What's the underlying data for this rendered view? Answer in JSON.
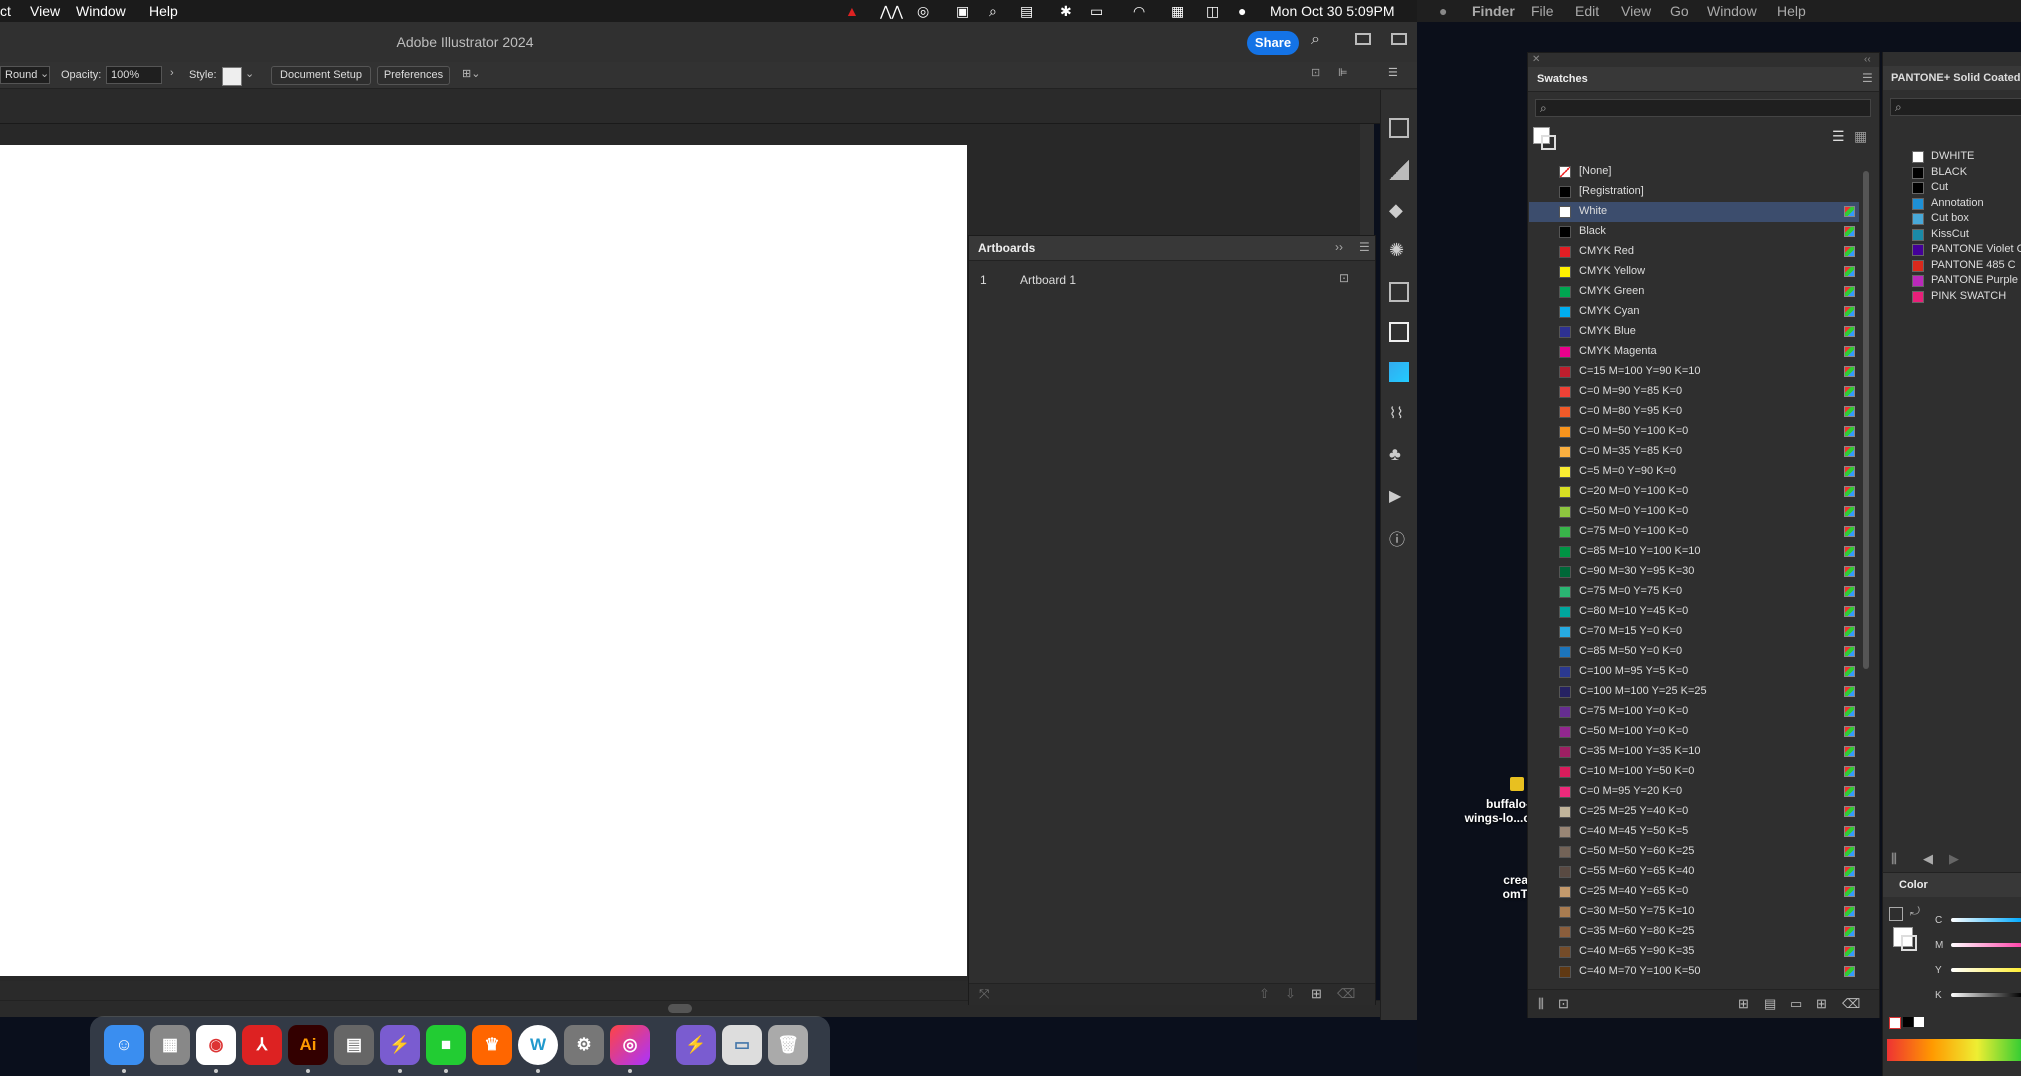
{
  "left_menubar": {
    "items": [
      "ct",
      "View",
      "Window",
      "Help"
    ],
    "clock": "Mon Oct 30  5:09PM"
  },
  "illustrator": {
    "title": "Adobe Illustrator 2024",
    "share_label": "Share",
    "control_bar": {
      "stroke_profile": "Round",
      "opacity_label": "Opacity:",
      "opacity_value": "100%",
      "style_label": "Style:",
      "document_setup": "Document Setup",
      "preferences": "Preferences"
    },
    "artboards_panel": {
      "title": "Artboards",
      "rows": [
        {
          "index": "1",
          "name": "Artboard 1"
        }
      ]
    }
  },
  "right_menubar": {
    "items": [
      "Finder",
      "File",
      "Edit",
      "View",
      "Go",
      "Window",
      "Help"
    ]
  },
  "desktop": {
    "icons": [
      {
        "label_line1": "buffalo-",
        "label_line2": "wings-lo...c"
      },
      {
        "label_line1": "crea",
        "label_line2": "omT"
      }
    ]
  },
  "swatches": {
    "title": "Swatches",
    "colors": {
      "selection": "#3c4d6d",
      "accent": "#1473e6"
    },
    "items": [
      {
        "name": "[None]",
        "color": "none"
      },
      {
        "name": "[Registration]",
        "color": "#000000"
      },
      {
        "name": "White",
        "color": "#ffffff",
        "selected": true
      },
      {
        "name": "Black",
        "color": "#000000"
      },
      {
        "name": "CMYK Red",
        "color": "#e31e24"
      },
      {
        "name": "CMYK Yellow",
        "color": "#fff200"
      },
      {
        "name": "CMYK Green",
        "color": "#00a651"
      },
      {
        "name": "CMYK Cyan",
        "color": "#00aeef"
      },
      {
        "name": "CMYK Blue",
        "color": "#2e3192"
      },
      {
        "name": "CMYK Magenta",
        "color": "#ec008c"
      },
      {
        "name": "C=15 M=100 Y=90 K=10",
        "color": "#be1e2d"
      },
      {
        "name": "C=0 M=90 Y=85 K=0",
        "color": "#ef4136"
      },
      {
        "name": "C=0 M=80 Y=95 K=0",
        "color": "#f15a29"
      },
      {
        "name": "C=0 M=50 Y=100 K=0",
        "color": "#f7941d"
      },
      {
        "name": "C=0 M=35 Y=85 K=0",
        "color": "#fbb040"
      },
      {
        "name": "C=5 M=0 Y=90 K=0",
        "color": "#f9ed32"
      },
      {
        "name": "C=20 M=0 Y=100 K=0",
        "color": "#d7df23"
      },
      {
        "name": "C=50 M=0 Y=100 K=0",
        "color": "#8dc63f"
      },
      {
        "name": "C=75 M=0 Y=100 K=0",
        "color": "#39b54a"
      },
      {
        "name": "C=85 M=10 Y=100 K=10",
        "color": "#009444"
      },
      {
        "name": "C=90 M=30 Y=95 K=30",
        "color": "#006838"
      },
      {
        "name": "C=75 M=0 Y=75 K=0",
        "color": "#2bb673"
      },
      {
        "name": "C=80 M=10 Y=45 K=0",
        "color": "#00a79d"
      },
      {
        "name": "C=70 M=15 Y=0 K=0",
        "color": "#27aae1"
      },
      {
        "name": "C=85 M=50 Y=0 K=0",
        "color": "#1c75bc"
      },
      {
        "name": "C=100 M=95 Y=5 K=0",
        "color": "#2b3990"
      },
      {
        "name": "C=100 M=100 Y=25 K=25",
        "color": "#262262"
      },
      {
        "name": "C=75 M=100 Y=0 K=0",
        "color": "#662d91"
      },
      {
        "name": "C=50 M=100 Y=0 K=0",
        "color": "#92278f"
      },
      {
        "name": "C=35 M=100 Y=35 K=10",
        "color": "#9e1f63"
      },
      {
        "name": "C=10 M=100 Y=50 K=0",
        "color": "#da1c5c"
      },
      {
        "name": "C=0 M=95 Y=20 K=0",
        "color": "#ee2a7b"
      },
      {
        "name": "C=25 M=25 Y=40 K=0",
        "color": "#c2b59b"
      },
      {
        "name": "C=40 M=45 Y=50 K=5",
        "color": "#998675"
      },
      {
        "name": "C=50 M=50 Y=60 K=25",
        "color": "#736357"
      },
      {
        "name": "C=55 M=60 Y=65 K=40",
        "color": "#594a42"
      },
      {
        "name": "C=25 M=40 Y=65 K=0",
        "color": "#c49a6c"
      },
      {
        "name": "C=30 M=50 Y=75 K=10",
        "color": "#a97c50"
      },
      {
        "name": "C=35 M=60 Y=80 K=25",
        "color": "#8b5e3c"
      },
      {
        "name": "C=40 M=65 Y=90 K=35",
        "color": "#754c29"
      },
      {
        "name": "C=40 M=70 Y=100 K=50",
        "color": "#603913"
      }
    ]
  },
  "pantone": {
    "title": "PANTONE+ Solid Coated",
    "items": [
      {
        "name": "DWHITE",
        "color": "#ffffff"
      },
      {
        "name": "BLACK",
        "color": "#000000"
      },
      {
        "name": "Cut",
        "color": "#000000"
      },
      {
        "name": "Annotation",
        "color": "#1e90d6"
      },
      {
        "name": "Cut box",
        "color": "#48a8d8"
      },
      {
        "name": "KissCut",
        "color": "#1a8aa8"
      },
      {
        "name": "PANTONE Violet C",
        "color": "#440099"
      },
      {
        "name": "PANTONE 485 C",
        "color": "#da291c"
      },
      {
        "name": "PANTONE Purple C",
        "color": "#bb29bb"
      },
      {
        "name": "PINK SWATCH",
        "color": "#e8207a"
      }
    ]
  },
  "color_panel": {
    "title": "Color",
    "channels": [
      "C",
      "M",
      "Y",
      "K"
    ]
  }
}
